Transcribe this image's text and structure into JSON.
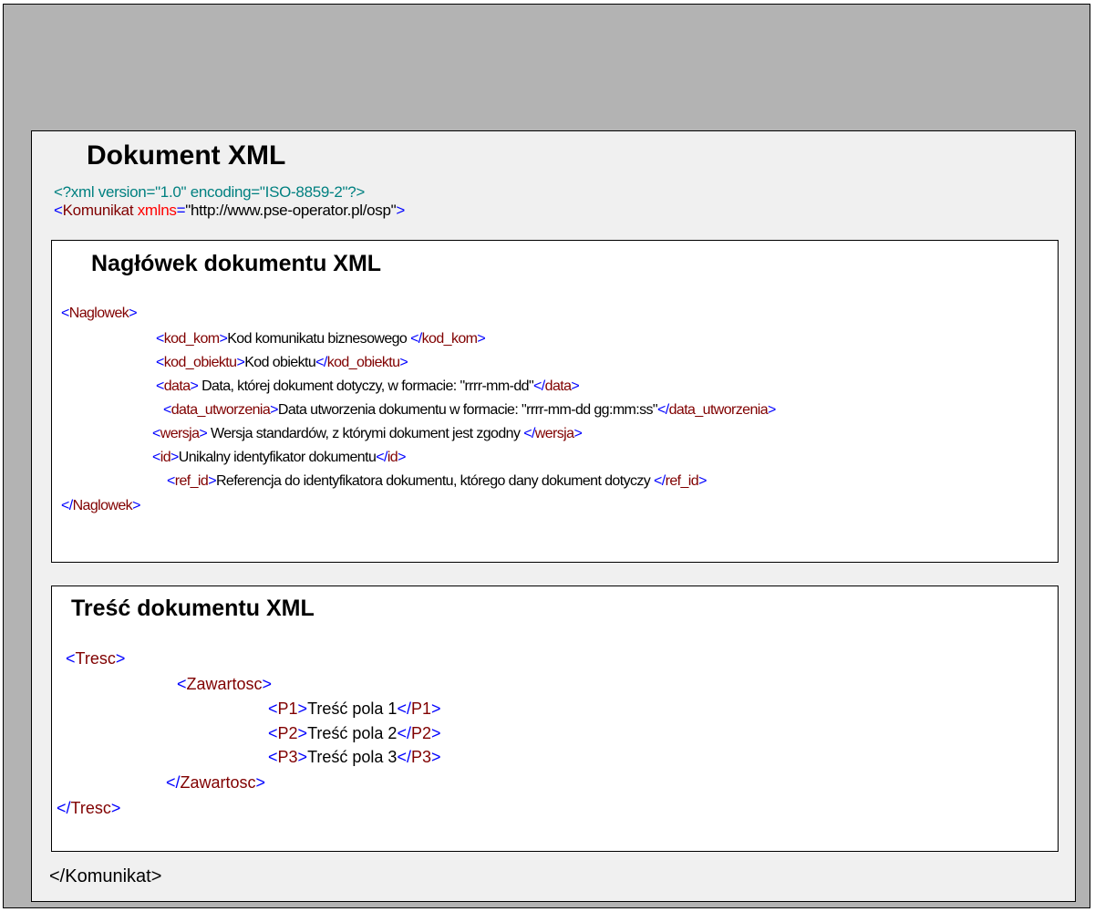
{
  "document": {
    "title": "Dokument  XML",
    "xml_declaration": "<?xml version=\"1.0\" encoding=\"ISO-8859-2\"?>",
    "root": {
      "open_bracket": "<",
      "tag": "Komunikat",
      "attr_name": "xmlns",
      "equals": "=",
      "attr_value": "\"http://www.pse-operator.pl/osp\"",
      "close_bracket": ">"
    },
    "closing_tag": "</Komunikat>"
  },
  "header_section": {
    "title": "Nagłówek  dokumentu  XML",
    "open_tag": "Naglowek",
    "close_tag": "Naglowek",
    "fields": [
      {
        "tag": "kod_kom",
        "text": "Kod komunikatu biznesowego "
      },
      {
        "tag": "kod_obiektu",
        "text": "Kod obiektu"
      },
      {
        "tag": "data",
        "text": " Data, której dokument dotyczy, w formacie: \"rrrr-mm-dd\""
      },
      {
        "tag": "data_utworzenia",
        "text": "Data utworzenia dokumentu w formacie: \"rrrr-mm-dd gg:mm:ss\""
      },
      {
        "tag": "wersja",
        "text": " Wersja standardów, z którymi dokument jest zgodny "
      },
      {
        "tag": "id",
        "text": "Unikalny identyfikator dokumentu"
      },
      {
        "tag": "ref_id",
        "text": "Referencja do identyfikatora dokumentu, którego dany dokument dotyczy "
      }
    ]
  },
  "content_section": {
    "title": "Treść  dokumentu  XML",
    "open_tag": "Tresc",
    "close_tag": "Tresc",
    "inner_tag": "Zawartosc",
    "fields": [
      {
        "tag": "P1",
        "text": "Treść pola 1"
      },
      {
        "tag": "P2",
        "text": "Treść pola 2"
      },
      {
        "tag": "P3",
        "text": "Treść pola 3"
      }
    ]
  },
  "syntax": {
    "lt": "<",
    "gt": ">",
    "lt_slash": "</"
  },
  "colors": {
    "outer_background": "#b3b3b3",
    "document_background": "#f0f0f0",
    "section_background": "#ffffff",
    "bracket": "#0000ff",
    "tag_name": "#800000",
    "declaration": "#008080",
    "attribute": "#ff0000"
  }
}
